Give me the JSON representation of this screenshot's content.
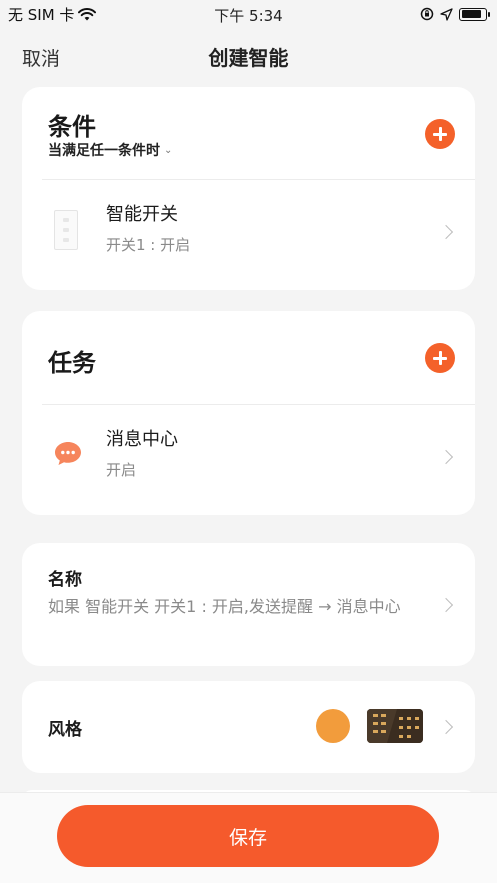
{
  "status_bar": {
    "carrier": "无 SIM 卡",
    "time": "下午 5:34",
    "battery_level": 0.85
  },
  "nav": {
    "cancel_label": "取消",
    "title": "创建智能"
  },
  "conditions": {
    "title": "条件",
    "mode_label": "当满足任一条件时",
    "items": [
      {
        "name": "智能开关",
        "detail": "开关1 : 开启",
        "icon": "switch-panel-icon"
      }
    ]
  },
  "tasks": {
    "title": "任务",
    "items": [
      {
        "name": "消息中心",
        "detail": "开启",
        "icon": "message-bubble-icon"
      }
    ]
  },
  "name_section": {
    "title": "名称",
    "description": "如果 智能开关 开关1 : 开启,发送提醒 → 消息中心"
  },
  "style_section": {
    "title": "风格",
    "color": "#f29c3c"
  },
  "footer": {
    "save_label": "保存"
  },
  "colors": {
    "accent": "#f4612a",
    "save_button": "#f55a2c",
    "background": "#f4f4f4"
  }
}
